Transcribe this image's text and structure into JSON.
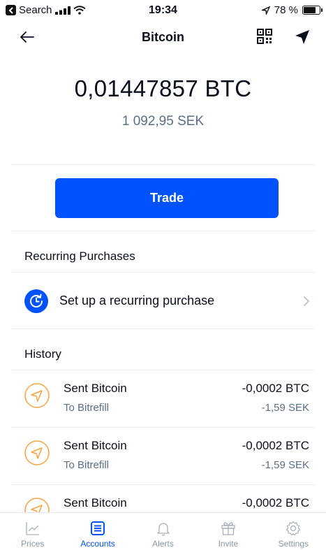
{
  "status_bar": {
    "back_app": "Search",
    "time": "19:34",
    "battery": "78 %",
    "battery_level": 0.78
  },
  "nav": {
    "title": "Bitcoin"
  },
  "balance": {
    "crypto": "0,01447857 BTC",
    "fiat": "1 092,95 SEK"
  },
  "trade": {
    "label": "Trade"
  },
  "recurring": {
    "header": "Recurring Purchases",
    "setup_label": "Set up a recurring purchase"
  },
  "history": {
    "header": "History",
    "items": [
      {
        "title": "Sent Bitcoin",
        "subtitle": "To Bitrefill",
        "amount": "-0,0002 BTC",
        "fiat": "-1,59 SEK"
      },
      {
        "title": "Sent Bitcoin",
        "subtitle": "To Bitrefill",
        "amount": "-0,0002 BTC",
        "fiat": "-1,59 SEK"
      },
      {
        "title": "Sent Bitcoin",
        "subtitle": "",
        "amount": "-0,0002 BTC",
        "fiat": ""
      }
    ]
  },
  "tabs": [
    {
      "label": "Prices",
      "icon": "chart-icon",
      "active": false
    },
    {
      "label": "Accounts",
      "icon": "accounts-icon",
      "active": true
    },
    {
      "label": "Alerts",
      "icon": "bell-icon",
      "active": false
    },
    {
      "label": "Invite",
      "icon": "gift-icon",
      "active": false
    },
    {
      "label": "Settings",
      "icon": "gear-icon",
      "active": false
    }
  ],
  "colors": {
    "accent": "#0052ff",
    "sent": "#f5a442",
    "muted": "#5b6f84"
  }
}
